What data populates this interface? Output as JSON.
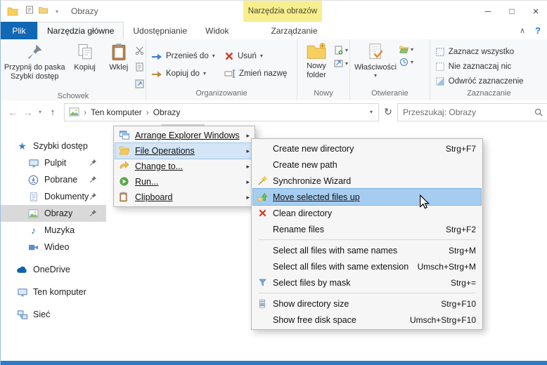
{
  "titlebar": {
    "title": "Obrazy",
    "contextual_group": "Narzędzia obrazów"
  },
  "tabs": {
    "file": "Plik",
    "home": "Narzędzia główne",
    "share": "Udostępnianie",
    "view": "Widok",
    "manage": "Zarządzanie"
  },
  "ribbon": {
    "pin_line1": "Przypnij do paska",
    "pin_line2": "Szybki dostęp",
    "copy": "Kopiuj",
    "paste": "Wklej",
    "move_to": "Przenieś do",
    "copy_to": "Kopiuj do",
    "delete": "Usuń",
    "rename": "Zmień nazwę",
    "new_folder_line1": "Nowy",
    "new_folder_line2": "folder",
    "properties": "Właściwości",
    "select_all": "Zaznacz wszystko",
    "select_none": "Nie zaznaczaj nic",
    "invert_selection": "Odwróć zaznaczenie",
    "groups": {
      "clipboard": "Schowek",
      "organize": "Organizowanie",
      "new": "Nowy",
      "open": "Otwieranie",
      "select": "Zaznaczanie"
    }
  },
  "addressbar": {
    "crumb_root": "Ten komputer",
    "crumb_current": "Obrazy",
    "search_placeholder": "Przeszukaj: Obrazy"
  },
  "sidebar": {
    "items": [
      {
        "label": "Szybki dostęp"
      },
      {
        "label": "Pulpit"
      },
      {
        "label": "Pobrane"
      },
      {
        "label": "Dokumenty"
      },
      {
        "label": "Obrazy"
      },
      {
        "label": "Muzyka"
      },
      {
        "label": "Wideo"
      },
      {
        "label": "OneDrive"
      },
      {
        "label": "Ten komputer"
      },
      {
        "label": "Sieć"
      }
    ]
  },
  "menu": {
    "items": [
      {
        "label": "Arrange Explorer Windows"
      },
      {
        "label": "File Operations"
      },
      {
        "label": "Change to..."
      },
      {
        "label": "Run..."
      },
      {
        "label": "Clipboard"
      }
    ]
  },
  "submenu": {
    "items": [
      {
        "label": "Create new directory",
        "shortcut": "Strg+F7"
      },
      {
        "label": "Create new path",
        "shortcut": ""
      },
      {
        "label": "Synchronize Wizard",
        "shortcut": ""
      },
      {
        "label": "Move selected files up",
        "shortcut": ""
      },
      {
        "label": "Clean directory",
        "shortcut": ""
      },
      {
        "label": "Rename files",
        "shortcut": "Strg+F2"
      },
      {
        "label": "Select all files with same names",
        "shortcut": "Strg+M"
      },
      {
        "label": "Select all files with same extension",
        "shortcut": "Umsch+Strg+M"
      },
      {
        "label": "Select files by mask",
        "shortcut": "Strg+="
      },
      {
        "label": "Show directory size",
        "shortcut": "Strg+F10"
      },
      {
        "label": "Show free disk space",
        "shortcut": "Umsch+Strg+F10"
      }
    ]
  },
  "glyphs": {
    "minimize": "─",
    "maximize": "□",
    "close": "×",
    "ribbon_collapse": "∧",
    "help": "?",
    "back": "←",
    "forward": "→",
    "up": "↑",
    "caret_down": "▾",
    "crumb_sep": "›",
    "refresh": "↻",
    "submenu_arrow": "▸",
    "star": "★",
    "music_note": "♪"
  },
  "colors": {
    "accent": "#1168b5",
    "contextual_yellow": "#f7ef8f",
    "submenu_highlight": "#a6cdf0",
    "sidebar_selected": "#d9d9d9"
  }
}
